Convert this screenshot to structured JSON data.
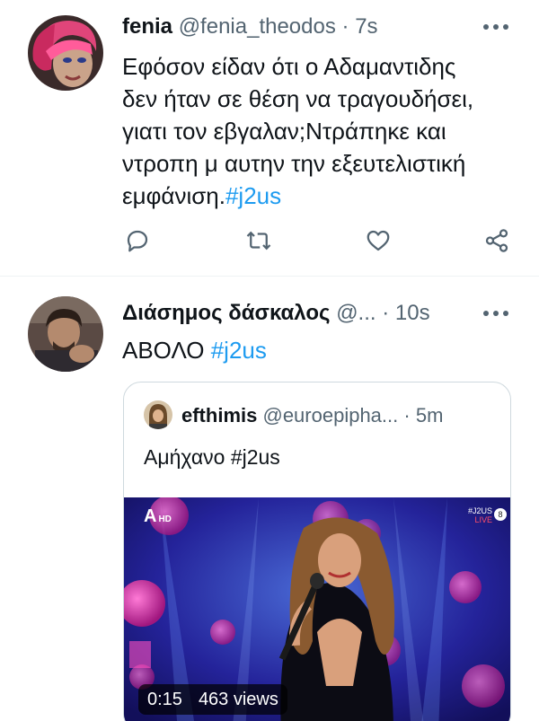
{
  "tweets": [
    {
      "name": "fenia",
      "handle": "@fenia_theodos",
      "separator": "·",
      "time": "7s",
      "text_lines": [
        "Εφόσον είδαν ότι ο Αδαμαντιδης",
        "δεν ήταν σε θέση να τραγουδήσει,",
        "γιατι τον εβγαλαν;Ντράπηκε και",
        "ντροπη μ αυτην την εξευτελιστική",
        "εμφάνιση."
      ],
      "hashtag": "#j2us",
      "icons": [
        "reply-icon",
        "retweet-icon",
        "like-icon",
        "share-icon"
      ]
    },
    {
      "name": "Διάσημος δάσκαλος",
      "handle": "@...",
      "separator": "·",
      "time": "10s",
      "text": "ΑΒΟΛΟ",
      "hashtag": "#j2us",
      "quote": {
        "name": "efthimis",
        "handle": "@euroepipha...",
        "separator": "·",
        "time": "5m",
        "text": "Αμήχανο #j2us",
        "video": {
          "channel_logo": "A",
          "channel_quality": "HD",
          "overlay_tag": "#J2US",
          "live_label": "LIVE",
          "rating": "8",
          "duration": "0:15",
          "views": "463 views"
        }
      }
    }
  ],
  "colors": {
    "text": "#0f1419",
    "secondary": "#536471",
    "hashtag": "#1d9bf0",
    "border": "#cfd9de"
  }
}
